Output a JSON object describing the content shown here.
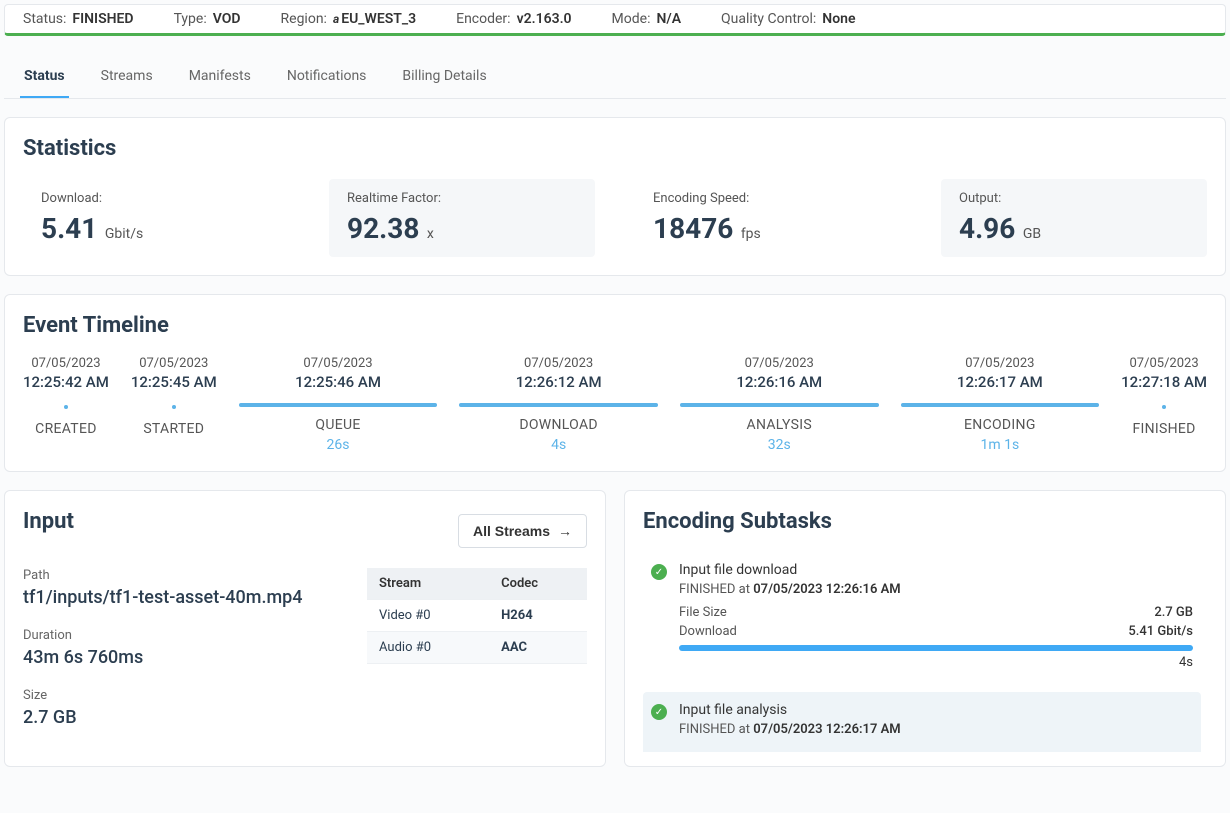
{
  "header": {
    "status_label": "Status:",
    "status_value": "FINISHED",
    "type_label": "Type:",
    "type_value": "VOD",
    "region_label": "Region:",
    "region_value": "EU_WEST_3",
    "encoder_label": "Encoder:",
    "encoder_value": "v2.163.0",
    "mode_label": "Mode:",
    "mode_value": "N/A",
    "qc_label": "Quality Control:",
    "qc_value": "None"
  },
  "tabs": {
    "status": "Status",
    "streams": "Streams",
    "manifests": "Manifests",
    "notifications": "Notifications",
    "billing": "Billing Details"
  },
  "statistics": {
    "title": "Statistics",
    "download_label": "Download:",
    "download_value": "5.41",
    "download_unit": "Gbit/s",
    "realtime_label": "Realtime Factor:",
    "realtime_value": "92.38",
    "realtime_unit": "x",
    "speed_label": "Encoding Speed:",
    "speed_value": "18476",
    "speed_unit": "fps",
    "output_label": "Output:",
    "output_value": "4.96",
    "output_unit": "GB"
  },
  "timeline": {
    "title": "Event Timeline",
    "items": [
      {
        "date": "07/05/2023",
        "time": "12:25:42 AM",
        "label": "CREATED",
        "duration": "",
        "phase": false
      },
      {
        "date": "07/05/2023",
        "time": "12:25:45 AM",
        "label": "STARTED",
        "duration": "",
        "phase": false
      },
      {
        "date": "07/05/2023",
        "time": "12:25:46 AM",
        "label": "QUEUE",
        "duration": "26s",
        "phase": true
      },
      {
        "date": "07/05/2023",
        "time": "12:26:12 AM",
        "label": "DOWNLOAD",
        "duration": "4s",
        "phase": true
      },
      {
        "date": "07/05/2023",
        "time": "12:26:16 AM",
        "label": "ANALYSIS",
        "duration": "32s",
        "phase": true
      },
      {
        "date": "07/05/2023",
        "time": "12:26:17 AM",
        "label": "ENCODING",
        "duration": "1m 1s",
        "phase": true
      },
      {
        "date": "07/05/2023",
        "time": "12:27:18 AM",
        "label": "FINISHED",
        "duration": "",
        "phase": false
      }
    ]
  },
  "input": {
    "title": "Input",
    "all_streams": "All Streams",
    "path_label": "Path",
    "path_value": "tf1/inputs/tf1-test-asset-40m.mp4",
    "duration_label": "Duration",
    "duration_value": "43m 6s 760ms",
    "size_label": "Size",
    "size_value": "2.7 GB",
    "table": {
      "col_stream": "Stream",
      "col_codec": "Codec",
      "rows": [
        {
          "stream": "Video #0",
          "codec": "H264"
        },
        {
          "stream": "Audio #0",
          "codec": "AAC"
        }
      ]
    }
  },
  "subtasks": {
    "title": "Encoding Subtasks",
    "items": [
      {
        "title": "Input file download",
        "status_prefix": "FINISHED at ",
        "status_ts": "07/05/2023 12:26:16 AM",
        "filesize_label": "File Size",
        "filesize_value": "2.7 GB",
        "download_label": "Download",
        "download_value": "5.41 Gbit/s",
        "duration": "4s"
      },
      {
        "title": "Input file analysis",
        "status_prefix": "FINISHED at ",
        "status_ts": "07/05/2023 12:26:17 AM"
      }
    ]
  }
}
